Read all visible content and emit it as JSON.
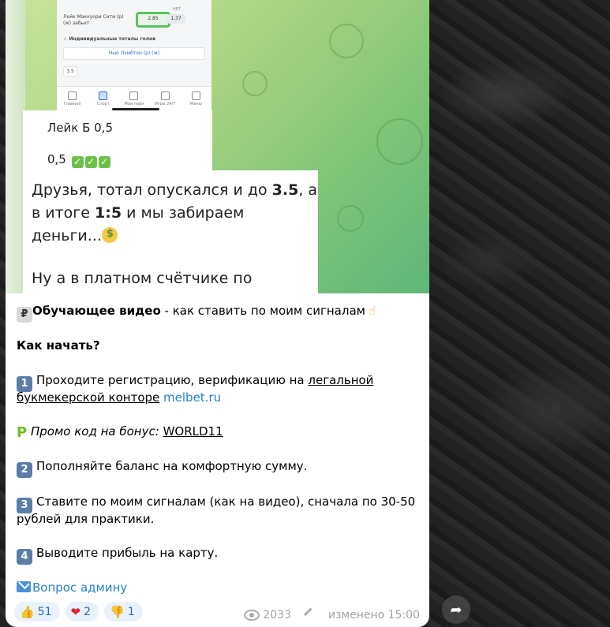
{
  "media": {
    "phone": {
      "row1_label": "Лейк Маккуори Сити (р) (ж) забьет",
      "odd_yes": "2.85",
      "odd_no_label": "НЕТ",
      "odd_no": "1.37",
      "section_title": "Индивидуальные тоталы голов",
      "team": "Нью Лэмбтон (р) (ж)",
      "total": "3.5",
      "tabs": [
        "Главное",
        "Спорт",
        "Мои пари",
        "Игры 24/7",
        "Меню"
      ]
    },
    "line_lake": "Лейк Б 0,5",
    "line_result": "0,5",
    "caption_line1_a": "Друзья, тотал опускался и до ",
    "caption_line1_b": "3.5",
    "caption_line1_c": ", а",
    "caption_line2_a": "в итоге ",
    "caption_line2_b": "1:5",
    "caption_line2_c": " и мы забираем",
    "caption_line3": "деньги...",
    "caption_line4": "Ну а в платном счётчике по"
  },
  "message": {
    "intro_bold": "Обучающее видео",
    "intro_rest": " - как ставить по моим сигналам",
    "how_start": "Как начать?",
    "step1_a": "Проходите регистрацию, верификацию на ",
    "step1_link": "легальной",
    "step1_line2_link": "букмекерской конторе",
    "step1_site": "melbet.ru",
    "promo_label": "Промо код на бонус:",
    "promo_code": "WORLD11",
    "step2": "Пополняйте баланс на комфортную сумму.",
    "step3_line1": "Ставите по моим сигналам (как на видео), сначала по 30-50",
    "step3_line2": "рублей для практики.",
    "step4": "Выводите прибыль на карту.",
    "admin_link": "Вопрос админу",
    "keys": [
      "1",
      "2",
      "3",
      "4"
    ]
  },
  "reactions": [
    {
      "emoji": "👍",
      "count": "51"
    },
    {
      "emoji": "❤",
      "count": "2"
    },
    {
      "emoji": "👎",
      "count": "1"
    }
  ],
  "meta": {
    "views": "2033",
    "edited": "изменено 15:00"
  },
  "colors": {
    "accent": "#2481cc",
    "reaction_bg": "#e9f1fb",
    "keycap": "#5b7ea8"
  }
}
